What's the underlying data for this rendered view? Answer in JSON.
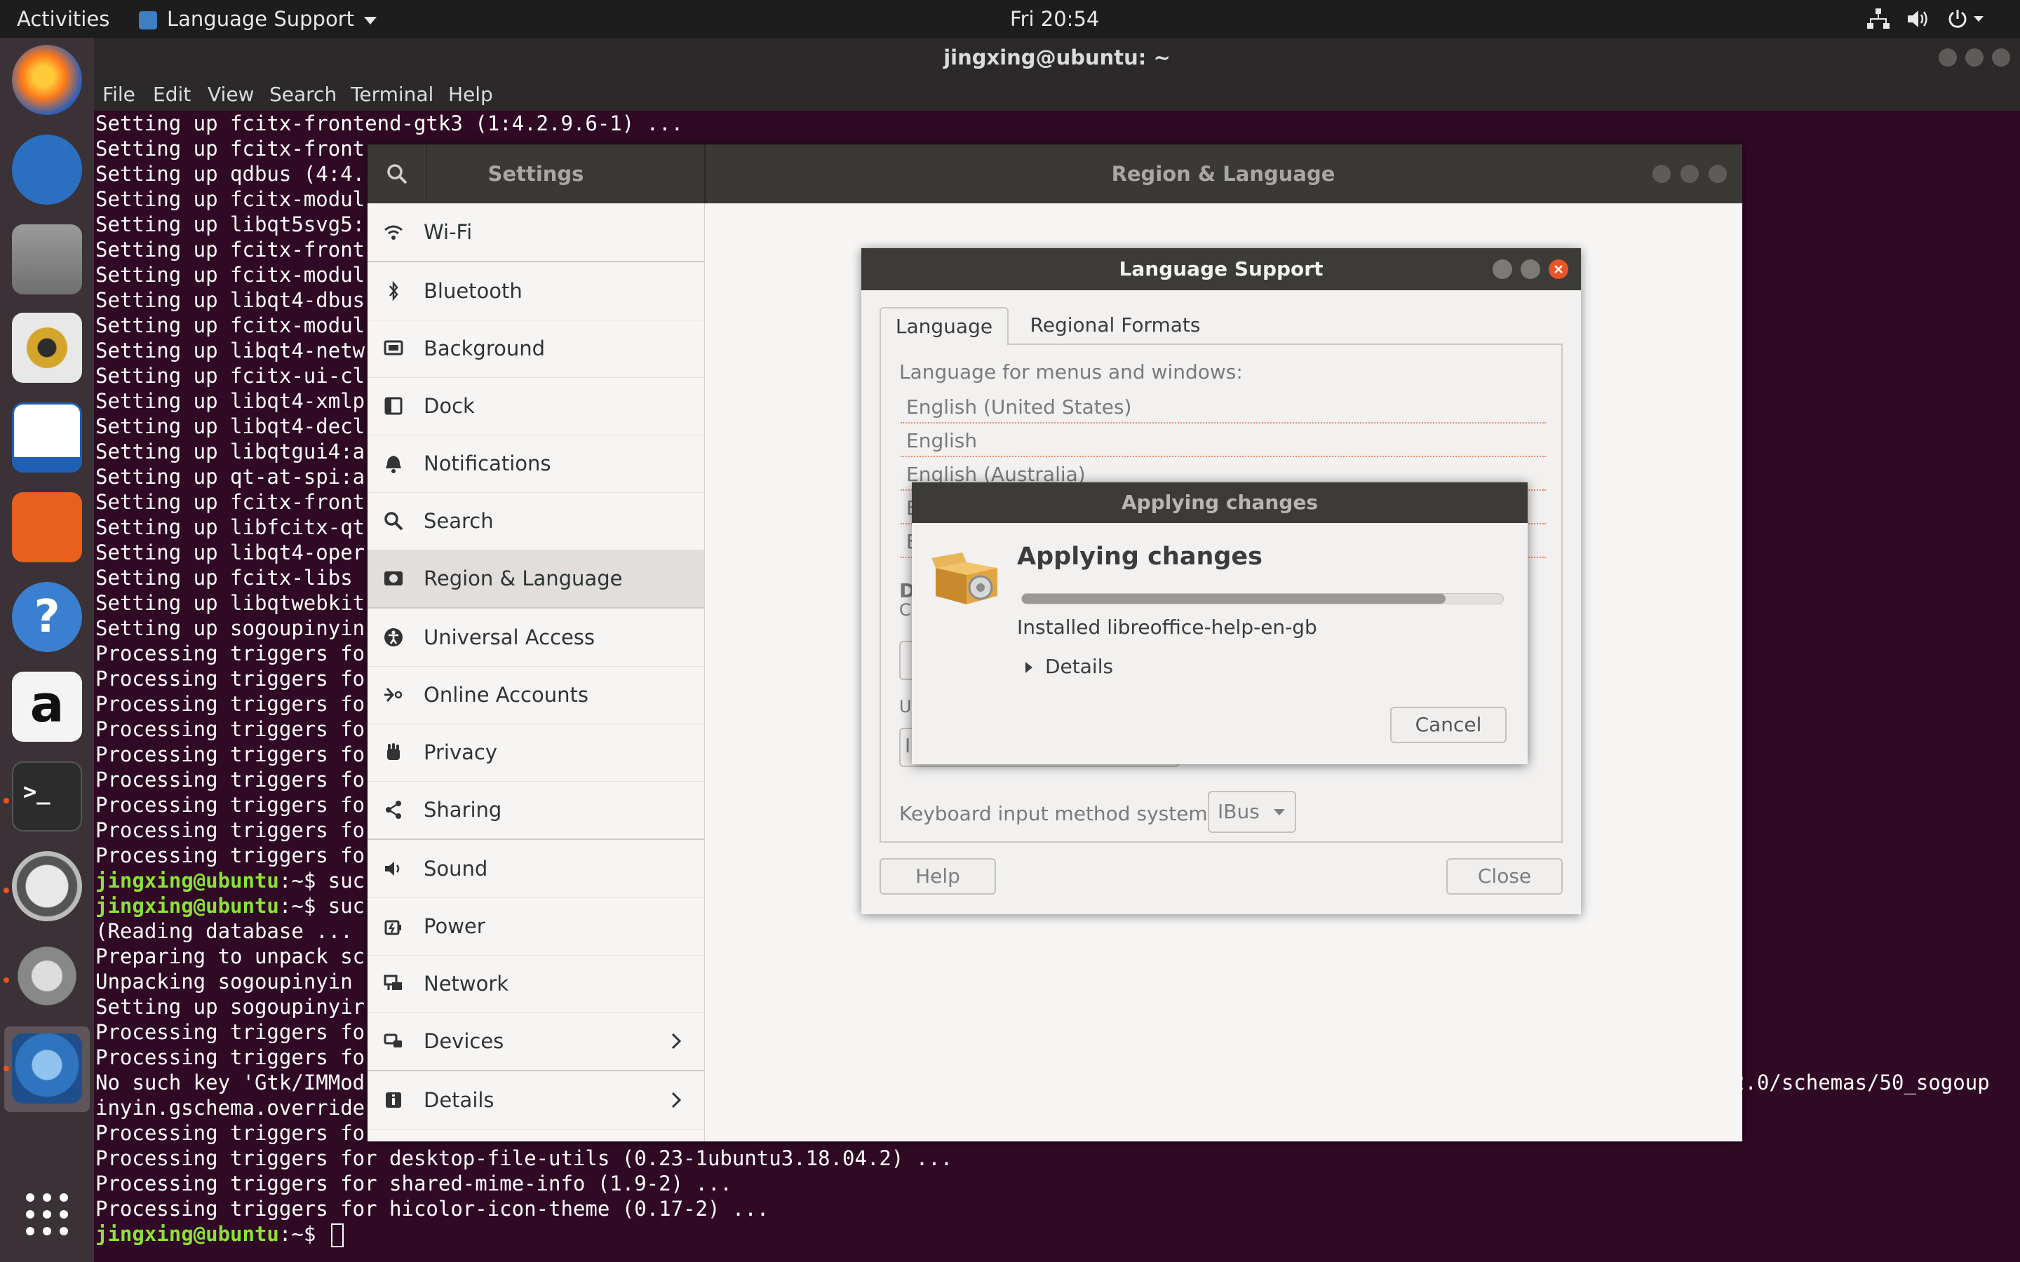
{
  "topbar": {
    "activities": "Activities",
    "app_name": "Language Support",
    "clock": "Fri 20:54"
  },
  "terminal": {
    "title": "jingxing@ubuntu: ~",
    "menu": [
      "File",
      "Edit",
      "View",
      "Search",
      "Terminal",
      "Help"
    ],
    "lines": [
      {
        "text": "Setting up fcitx-frontend-gtk3 (1:4.2.9.6-1) ..."
      },
      {
        "text": "Setting up fcitx-front"
      },
      {
        "text": "Setting up qdbus (4:4."
      },
      {
        "text": "Setting up fcitx-modul"
      },
      {
        "text": "Setting up libqt5svg5:"
      },
      {
        "text": "Setting up fcitx-front"
      },
      {
        "text": "Setting up fcitx-modul"
      },
      {
        "text": "Setting up libqt4-dbus"
      },
      {
        "text": "Setting up fcitx-modul"
      },
      {
        "text": "Setting up libqt4-netw"
      },
      {
        "text": "Setting up fcitx-ui-cl"
      },
      {
        "text": "Setting up libqt4-xmlp"
      },
      {
        "text": "Setting up libqt4-decl"
      },
      {
        "text": "Setting up libqtgui4:a"
      },
      {
        "text": "Setting up qt-at-spi:a"
      },
      {
        "text": "Setting up fcitx-front"
      },
      {
        "text": "Setting up libfcitx-qt"
      },
      {
        "text": "Setting up libqt4-oper"
      },
      {
        "text": "Setting up fcitx-libs"
      },
      {
        "text": "Setting up libqtwebkit"
      },
      {
        "text": "Setting up sogoupinyin"
      },
      {
        "text": "Processing triggers fo"
      },
      {
        "text": "Processing triggers fo"
      },
      {
        "text": "Processing triggers fo"
      },
      {
        "text": "Processing triggers fo"
      },
      {
        "text": "Processing triggers fo"
      },
      {
        "text": "Processing triggers fo"
      },
      {
        "text": "Processing triggers fo"
      },
      {
        "text": "Processing triggers fo"
      },
      {
        "text": "Processing triggers fo"
      },
      {
        "prompt": "jingxing@ubuntu",
        "rest": ":~$ suc"
      },
      {
        "prompt": "jingxing@ubuntu",
        "rest": ":~$ suc"
      },
      {
        "text": "(Reading database ..."
      },
      {
        "text": "Preparing to unpack sc"
      },
      {
        "text": "Unpacking sogoupinyin"
      },
      {
        "text": "Setting up sogoupinyir"
      },
      {
        "text": "Processing triggers fo"
      },
      {
        "text": "Processing triggers fo"
      },
      {
        "text": "No such key 'Gtk/IMMod",
        "tail": "2.0/schemas/50_sogoup"
      },
      {
        "text": "inyin.gschema.override"
      },
      {
        "text": "Processing triggers fo"
      },
      {
        "text": "Processing triggers for desktop-file-utils (0.23-1ubuntu3.18.04.2) ..."
      },
      {
        "text": "Processing triggers for shared-mime-info (1.9-2) ..."
      },
      {
        "text": "Processing triggers for hicolor-icon-theme (0.17-2) ..."
      },
      {
        "prompt": "jingxing@ubuntu",
        "rest": ":~$ ",
        "cursor": true
      }
    ]
  },
  "settings": {
    "title": "Settings",
    "panel_title": "Region & Language",
    "items": [
      {
        "label": "Wi-Fi",
        "icon": "wifi-icon"
      },
      {
        "label": "Bluetooth",
        "icon": "bluetooth-icon"
      },
      {
        "label": "Background",
        "icon": "background-icon"
      },
      {
        "label": "Dock",
        "icon": "dock-icon"
      },
      {
        "label": "Notifications",
        "icon": "bell-icon"
      },
      {
        "label": "Search",
        "icon": "search-icon"
      },
      {
        "label": "Region & Language",
        "icon": "region-icon",
        "active": true
      },
      {
        "label": "Universal Access",
        "icon": "accessibility-icon"
      },
      {
        "label": "Online Accounts",
        "icon": "online-accounts-icon"
      },
      {
        "label": "Privacy",
        "icon": "hand-icon"
      },
      {
        "label": "Sharing",
        "icon": "share-icon"
      },
      {
        "label": "Sound",
        "icon": "speaker-icon"
      },
      {
        "label": "Power",
        "icon": "power-icon"
      },
      {
        "label": "Network",
        "icon": "network-icon"
      },
      {
        "label": "Devices",
        "icon": "devices-icon",
        "chevron": true
      },
      {
        "label": "Details",
        "icon": "info-icon",
        "chevron": true
      }
    ]
  },
  "language_support": {
    "title": "Language Support",
    "tabs": [
      "Language",
      "Regional Formats"
    ],
    "menus_label": "Language for menus and windows:",
    "languages": [
      "English (United States)",
      "English",
      "English (Australia)",
      "E",
      "E"
    ],
    "partial_labels": [
      "Dr",
      "Ch",
      "A",
      "Us",
      "I"
    ],
    "keyboard_label": "Keyboard input method system:",
    "keyboard_value": "IBus",
    "help_button": "Help",
    "close_button": "Close"
  },
  "applying_changes": {
    "window_title": "Applying changes",
    "heading": "Applying changes",
    "progress": 0.88,
    "status": "Installed libreoffice-help-en-gb",
    "details": "Details",
    "cancel": "Cancel"
  },
  "colors": {
    "terminal_bg": "#300a24",
    "prompt": "#8ae234",
    "accent": "#e95420"
  }
}
